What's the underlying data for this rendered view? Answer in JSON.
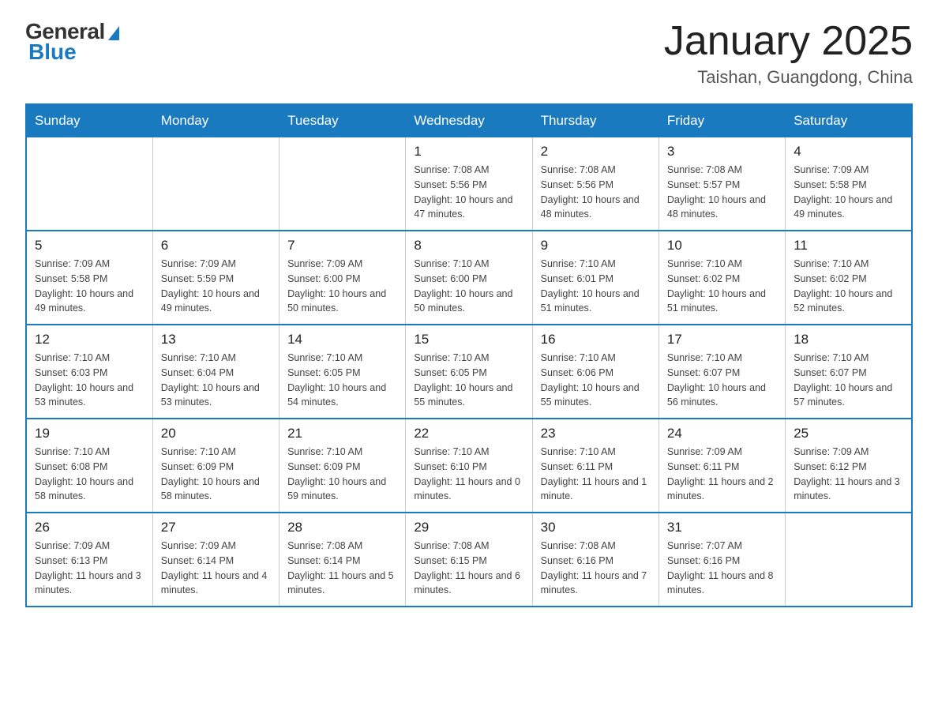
{
  "header": {
    "logo_general": "General",
    "logo_blue": "Blue",
    "month_title": "January 2025",
    "location": "Taishan, Guangdong, China"
  },
  "weekdays": [
    "Sunday",
    "Monday",
    "Tuesday",
    "Wednesday",
    "Thursday",
    "Friday",
    "Saturday"
  ],
  "weeks": [
    [
      {
        "day": "",
        "info": ""
      },
      {
        "day": "",
        "info": ""
      },
      {
        "day": "",
        "info": ""
      },
      {
        "day": "1",
        "info": "Sunrise: 7:08 AM\nSunset: 5:56 PM\nDaylight: 10 hours\nand 47 minutes."
      },
      {
        "day": "2",
        "info": "Sunrise: 7:08 AM\nSunset: 5:56 PM\nDaylight: 10 hours\nand 48 minutes."
      },
      {
        "day": "3",
        "info": "Sunrise: 7:08 AM\nSunset: 5:57 PM\nDaylight: 10 hours\nand 48 minutes."
      },
      {
        "day": "4",
        "info": "Sunrise: 7:09 AM\nSunset: 5:58 PM\nDaylight: 10 hours\nand 49 minutes."
      }
    ],
    [
      {
        "day": "5",
        "info": "Sunrise: 7:09 AM\nSunset: 5:58 PM\nDaylight: 10 hours\nand 49 minutes."
      },
      {
        "day": "6",
        "info": "Sunrise: 7:09 AM\nSunset: 5:59 PM\nDaylight: 10 hours\nand 49 minutes."
      },
      {
        "day": "7",
        "info": "Sunrise: 7:09 AM\nSunset: 6:00 PM\nDaylight: 10 hours\nand 50 minutes."
      },
      {
        "day": "8",
        "info": "Sunrise: 7:10 AM\nSunset: 6:00 PM\nDaylight: 10 hours\nand 50 minutes."
      },
      {
        "day": "9",
        "info": "Sunrise: 7:10 AM\nSunset: 6:01 PM\nDaylight: 10 hours\nand 51 minutes."
      },
      {
        "day": "10",
        "info": "Sunrise: 7:10 AM\nSunset: 6:02 PM\nDaylight: 10 hours\nand 51 minutes."
      },
      {
        "day": "11",
        "info": "Sunrise: 7:10 AM\nSunset: 6:02 PM\nDaylight: 10 hours\nand 52 minutes."
      }
    ],
    [
      {
        "day": "12",
        "info": "Sunrise: 7:10 AM\nSunset: 6:03 PM\nDaylight: 10 hours\nand 53 minutes."
      },
      {
        "day": "13",
        "info": "Sunrise: 7:10 AM\nSunset: 6:04 PM\nDaylight: 10 hours\nand 53 minutes."
      },
      {
        "day": "14",
        "info": "Sunrise: 7:10 AM\nSunset: 6:05 PM\nDaylight: 10 hours\nand 54 minutes."
      },
      {
        "day": "15",
        "info": "Sunrise: 7:10 AM\nSunset: 6:05 PM\nDaylight: 10 hours\nand 55 minutes."
      },
      {
        "day": "16",
        "info": "Sunrise: 7:10 AM\nSunset: 6:06 PM\nDaylight: 10 hours\nand 55 minutes."
      },
      {
        "day": "17",
        "info": "Sunrise: 7:10 AM\nSunset: 6:07 PM\nDaylight: 10 hours\nand 56 minutes."
      },
      {
        "day": "18",
        "info": "Sunrise: 7:10 AM\nSunset: 6:07 PM\nDaylight: 10 hours\nand 57 minutes."
      }
    ],
    [
      {
        "day": "19",
        "info": "Sunrise: 7:10 AM\nSunset: 6:08 PM\nDaylight: 10 hours\nand 58 minutes."
      },
      {
        "day": "20",
        "info": "Sunrise: 7:10 AM\nSunset: 6:09 PM\nDaylight: 10 hours\nand 58 minutes."
      },
      {
        "day": "21",
        "info": "Sunrise: 7:10 AM\nSunset: 6:09 PM\nDaylight: 10 hours\nand 59 minutes."
      },
      {
        "day": "22",
        "info": "Sunrise: 7:10 AM\nSunset: 6:10 PM\nDaylight: 11 hours\nand 0 minutes."
      },
      {
        "day": "23",
        "info": "Sunrise: 7:10 AM\nSunset: 6:11 PM\nDaylight: 11 hours\nand 1 minute."
      },
      {
        "day": "24",
        "info": "Sunrise: 7:09 AM\nSunset: 6:11 PM\nDaylight: 11 hours\nand 2 minutes."
      },
      {
        "day": "25",
        "info": "Sunrise: 7:09 AM\nSunset: 6:12 PM\nDaylight: 11 hours\nand 3 minutes."
      }
    ],
    [
      {
        "day": "26",
        "info": "Sunrise: 7:09 AM\nSunset: 6:13 PM\nDaylight: 11 hours\nand 3 minutes."
      },
      {
        "day": "27",
        "info": "Sunrise: 7:09 AM\nSunset: 6:14 PM\nDaylight: 11 hours\nand 4 minutes."
      },
      {
        "day": "28",
        "info": "Sunrise: 7:08 AM\nSunset: 6:14 PM\nDaylight: 11 hours\nand 5 minutes."
      },
      {
        "day": "29",
        "info": "Sunrise: 7:08 AM\nSunset: 6:15 PM\nDaylight: 11 hours\nand 6 minutes."
      },
      {
        "day": "30",
        "info": "Sunrise: 7:08 AM\nSunset: 6:16 PM\nDaylight: 11 hours\nand 7 minutes."
      },
      {
        "day": "31",
        "info": "Sunrise: 7:07 AM\nSunset: 6:16 PM\nDaylight: 11 hours\nand 8 minutes."
      },
      {
        "day": "",
        "info": ""
      }
    ]
  ]
}
